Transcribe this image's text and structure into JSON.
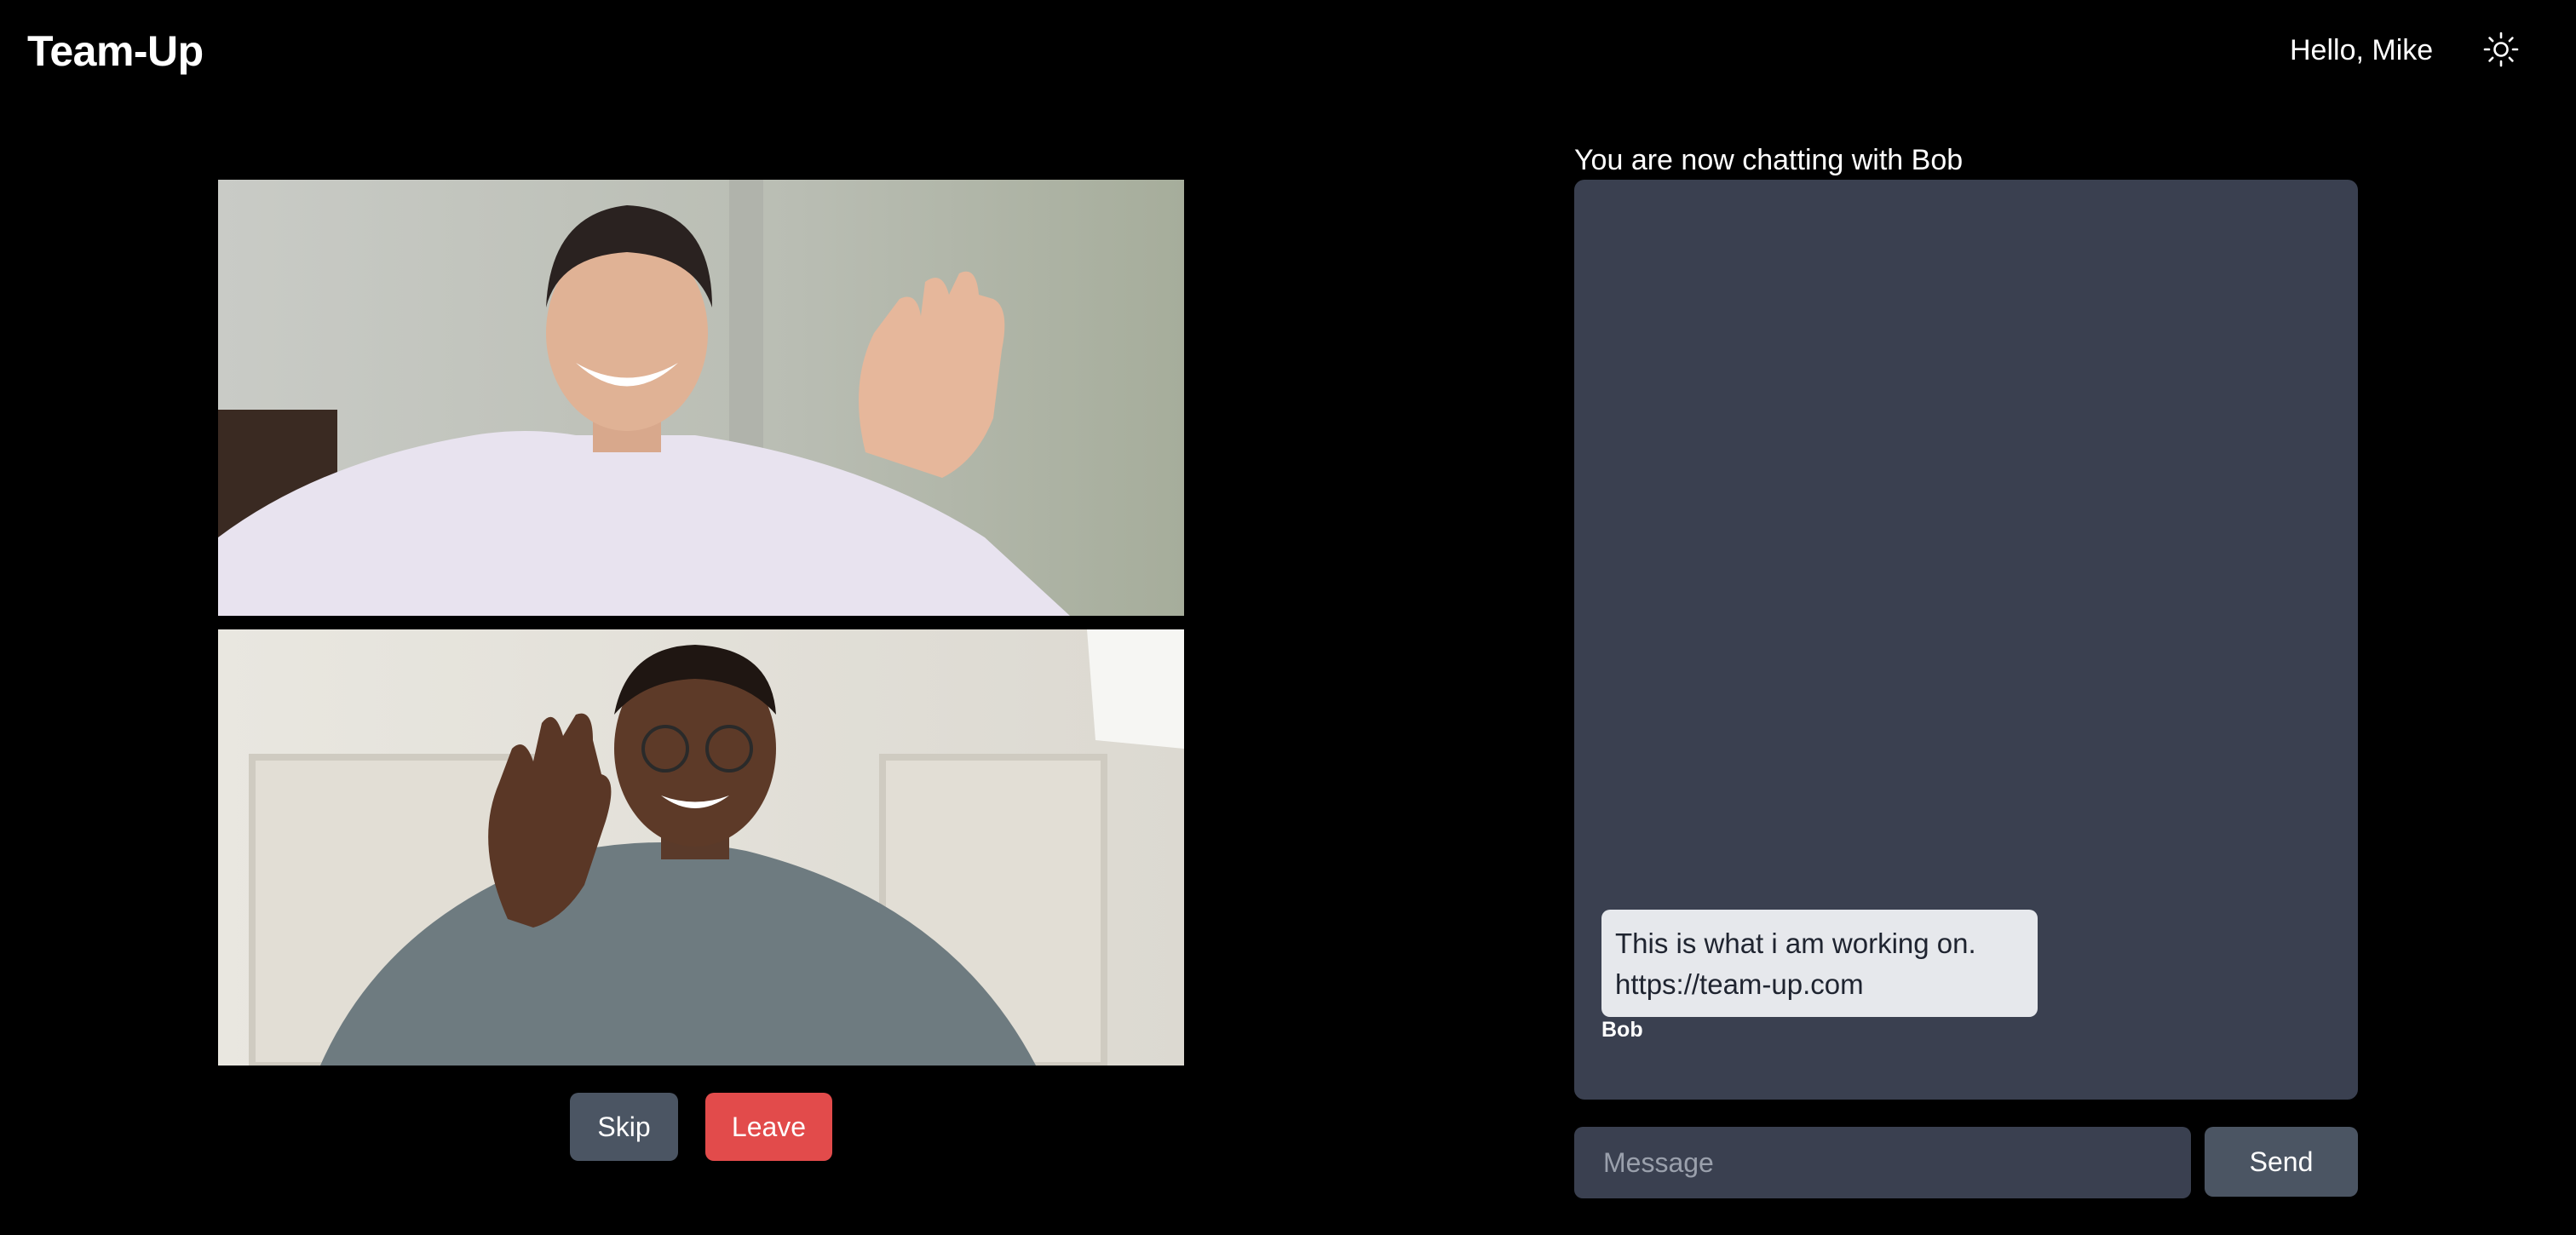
{
  "header": {
    "brand": "Team-Up",
    "greeting": "Hello, Mike",
    "theme_icon": "sun-icon"
  },
  "video": {
    "top_participant_icon": "video-feed",
    "bottom_participant_icon": "video-feed"
  },
  "controls": {
    "skip_label": "Skip",
    "leave_label": "Leave",
    "skip_color": "#4b5563",
    "leave_color": "#e24b4b"
  },
  "chat": {
    "heading": "You are now chatting with Bob",
    "panel_color": "#3a4050",
    "messages": [
      {
        "lines": [
          "This is what i am working on.",
          "https://team-up.com"
        ],
        "sender": "Bob"
      }
    ],
    "input_placeholder": "Message",
    "input_value": "",
    "send_label": "Send"
  }
}
